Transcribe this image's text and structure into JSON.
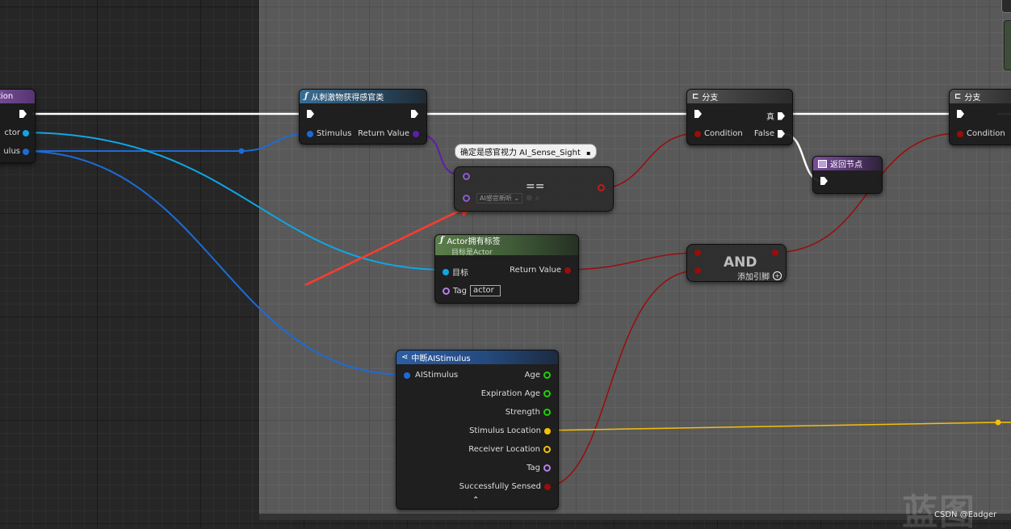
{
  "nodes": {
    "left_node": {
      "title": "tion",
      "pin_actor": "ctor",
      "pin_stimulus": "ulus"
    },
    "get_sense_class": {
      "title": "从刺激物获得感官类",
      "pin_in": "Stimulus",
      "pin_out": "Return Value"
    },
    "tooltip": {
      "text": "确定是感官视力 AI_Sense_Sight"
    },
    "equal": {
      "symbol": "==",
      "select_value": "AI感官新听"
    },
    "has_tag": {
      "title": "Actor拥有标签",
      "subtitle": "目标是Actor",
      "pin_target": "目标",
      "pin_tag": "Tag",
      "tag_value": "actor",
      "pin_out": "Return Value"
    },
    "branch1": {
      "title": "分支",
      "pin_true": "真",
      "pin_condition": "Condition",
      "pin_false": "False"
    },
    "branch2": {
      "title": "分支",
      "pin_condition": "Condition"
    },
    "return_node": {
      "title": "返回节点"
    },
    "and_node": {
      "symbol": "AND",
      "add_pin": "添加引脚"
    },
    "break_stimulus": {
      "title": "中断AIStimulus",
      "pin_in": "AIStimulus",
      "outputs": [
        "Age",
        "Expiration Age",
        "Strength",
        "Stimulus Location",
        "Receiver Location",
        "Tag",
        "Successfully Sensed"
      ]
    }
  },
  "watermark": "蓝图",
  "credit": "CSDN @Eadger",
  "colors": {
    "struct": "#1d6bd6",
    "object": "#10a6e6",
    "bool": "#9b0c0c",
    "class": "#5b1fa8",
    "float": "#1fcf0a",
    "vector": "#f5bf0a",
    "name": "#b780e8",
    "exec": "#ffffff",
    "arrow": "#ff3b30"
  }
}
